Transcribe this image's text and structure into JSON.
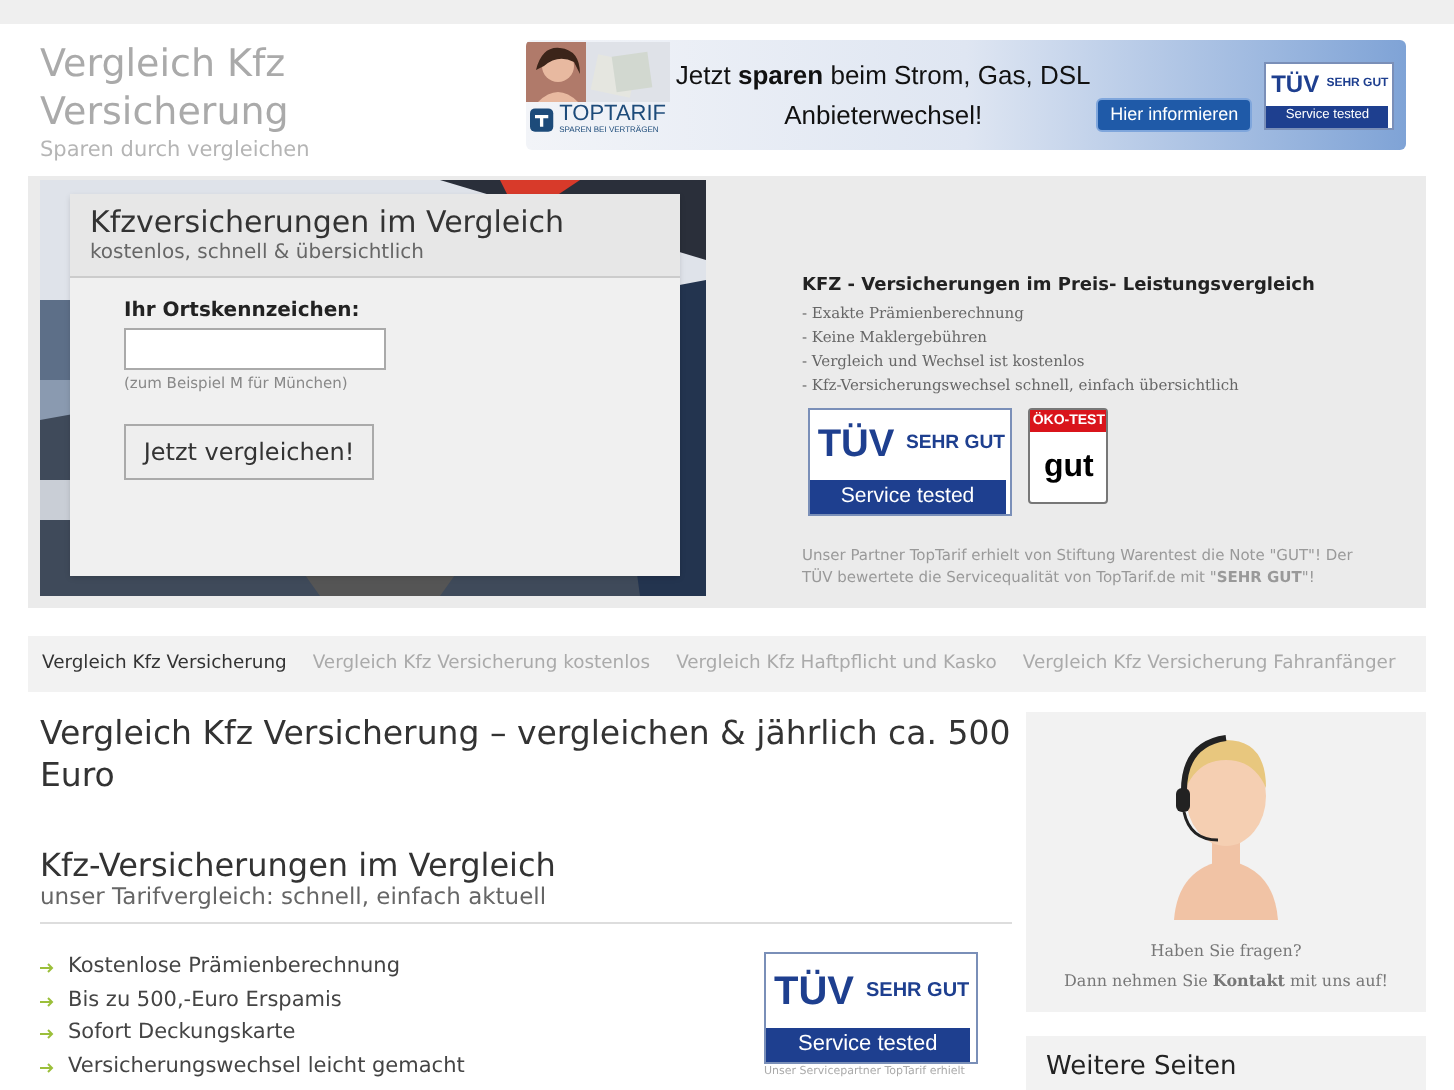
{
  "header": {
    "title": "Vergleich Kfz Versicherung",
    "tagline": "Sparen durch vergleichen"
  },
  "banner": {
    "headline": "Jetzt **sparen** beim Strom, Gas, DSL",
    "headline_2": "Anbieterwechsel!",
    "brand": "TOPTARIF",
    "brand_sub": "SPAREN BEI VERTRÄGEN",
    "button": "Hier informieren",
    "badge": {
      "mark": "TÜV",
      "rating": "SEHR GUT",
      "footer": "Service tested"
    }
  },
  "hero": {
    "form": {
      "title": "Kfzversicherungen im Vergleich",
      "subtitle": "kostenlos, schnell & übersichtlich",
      "field_label": "Ihr Ortskennzeichen:",
      "hint": "(zum Beispiel M für München)",
      "button": "Jetzt vergleichen!"
    },
    "info": {
      "heading": "KFZ - Versicherungen im Preis- Leistungsvergleich",
      "bullets": [
        "- Exakte Prämienberechnung",
        "- Keine Maklergebühren",
        "- Vergleich und Wechsel ist kostenlos",
        "- Kfz-Versicherungswechsel schnell, einfach übersichtlich"
      ],
      "tuv_badge": {
        "mark": "TÜV",
        "rating": "SEHR GUT",
        "footer": "Service tested"
      },
      "oeko_badge": {
        "mark": "ÖKO-TEST",
        "rating": "gut"
      },
      "note": "Unser Partner TopTarif erhielt von Stiftung Warentest die Note \"GUT\"! Der TÜV bewertete die Servicequalität von TopTarif.de mit \"**SEHR GUT**\"!"
    }
  },
  "nav": [
    {
      "label": "Vergleich Kfz Versicherung",
      "selected": true
    },
    {
      "label": "Vergleich Kfz Versicherung kostenlos",
      "selected": false
    },
    {
      "label": "Vergleich Kfz Haftpflicht und Kasko",
      "selected": false
    },
    {
      "label": "Vergleich Kfz Versicherung Fahranfänger",
      "selected": false
    }
  ],
  "main": {
    "heading": "Vergleich Kfz Versicherung – vergleichen & jährlich ca. 500 Euro",
    "section_title": "Kfz-Versicherungen im Vergleich",
    "section_subtitle": "unser Tarifvergleich: schnell, einfach aktuell",
    "features": [
      "Kostenlose Prämienberechnung",
      "Bis zu 500,-Euro Erspamis",
      "Sofort Deckungskarte",
      "Versicherungswechsel leicht gemacht"
    ],
    "tuv_badge": {
      "mark": "TÜV",
      "rating": "SEHR GUT",
      "footer": "Service tested"
    },
    "badge_caption": "Unser Servicepartner TopTarif erhielt"
  },
  "sidebar": {
    "contact_question": "Haben Sie fragen?",
    "contact_text": "Dann nehmen Sie **Kontakt** mit uns auf!",
    "more_title": "Weitere Seiten"
  }
}
